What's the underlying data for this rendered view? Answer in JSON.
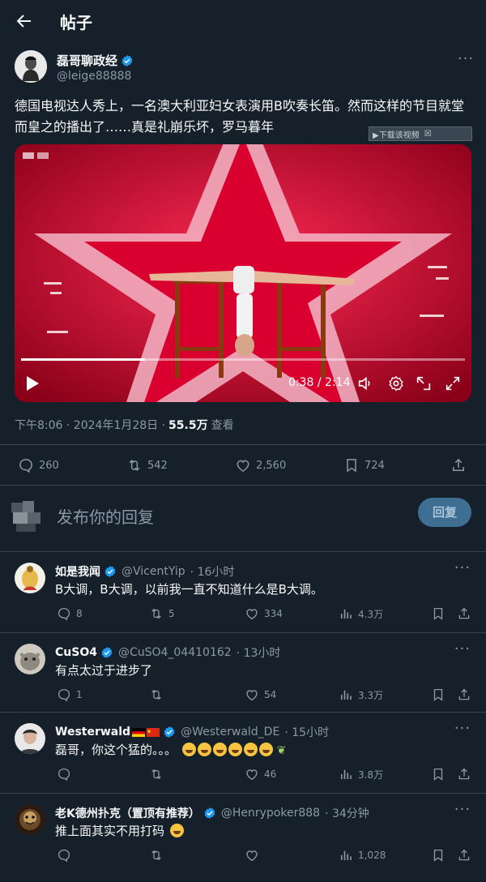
{
  "header": {
    "title": "帖子"
  },
  "post": {
    "author_name": "磊哥聊政经",
    "author_handle": "@leige88888",
    "text": "德国电视达人秀上，一名澳大利亚妇女表演用B吹奏长笛。然而这样的节目就堂而皇之的播出了……真是礼崩乐坏，罗马暮年",
    "ad_badge": "▶下载该视频",
    "video": {
      "current_time": "0:38",
      "duration": "2:14",
      "time_display": "0:38 / 2:14",
      "progress": 0.28
    },
    "timestamp": "下午8:06 · 2024年1月28日 ·",
    "views_count": "55.5万",
    "views_label": "查看",
    "stats": {
      "replies": "260",
      "reposts": "542",
      "likes": "2,560",
      "bookmarks": "724"
    }
  },
  "compose": {
    "placeholder": "发布你的回复",
    "button": "回复"
  },
  "replies": [
    {
      "name": "如是我闻",
      "handle": "@VicentYip",
      "time": "· 16小时",
      "text": "B大调，B大调，以前我一直不知道什么是B大调。",
      "replies": "8",
      "reposts": "5",
      "likes": "334",
      "views": "4.3万"
    },
    {
      "name": "CuSO4",
      "handle": "@CuSO4_04410162",
      "time": "· 13小时",
      "text": "有点太过于进步了",
      "replies": "1",
      "reposts": "",
      "likes": "54",
      "views": "3.3万"
    },
    {
      "name": "Westerwald",
      "handle": "@Westerwald_DE",
      "time": "· 15小时",
      "text": "磊哥，你这个猛的。。。",
      "replies": "",
      "reposts": "",
      "likes": "46",
      "views": "3.8万"
    },
    {
      "name": "老K德州扑克（置顶有推荐）",
      "handle": "@Henrypoker888",
      "time": "· 34分钟",
      "text": "推上面其实不用打码",
      "replies": "",
      "reposts": "",
      "likes": "",
      "views": "1,028"
    }
  ],
  "colors": {
    "background": "#15202b",
    "accent": "#1d9bf0",
    "muted": "#8b98a5",
    "divider": "#38444d"
  },
  "icons": [
    "back-arrow-icon",
    "verified-badge-icon",
    "more-icon",
    "play-icon",
    "volume-icon",
    "settings-icon",
    "pip-icon",
    "fullscreen-icon",
    "reply-icon",
    "repost-icon",
    "like-icon",
    "bookmark-icon",
    "share-icon",
    "views-icon"
  ]
}
